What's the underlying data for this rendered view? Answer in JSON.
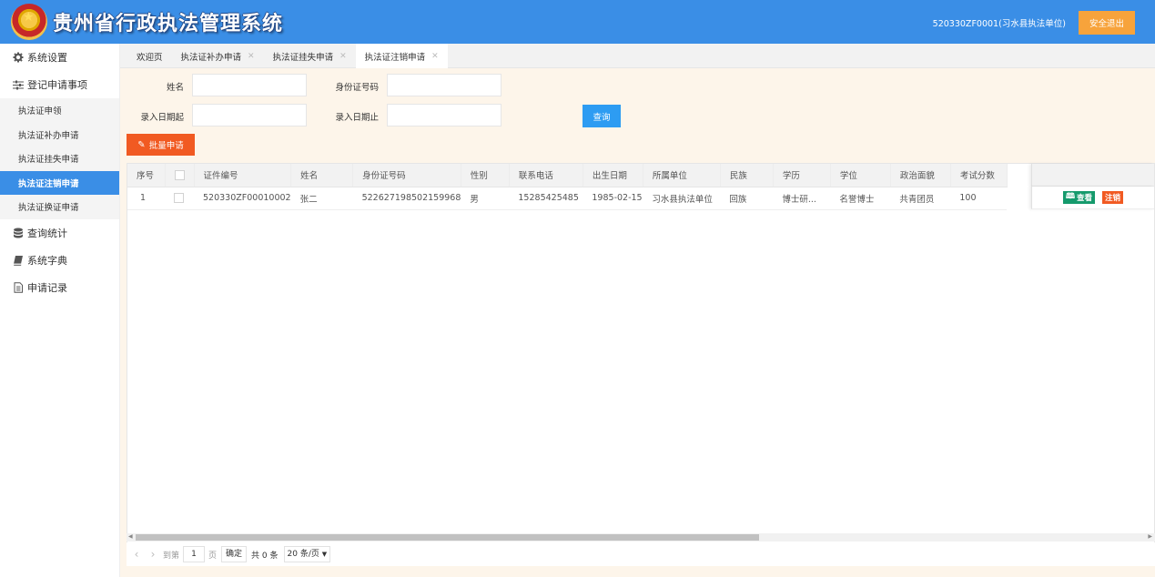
{
  "header": {
    "app_title": "贵州省行政执法管理系统",
    "user_info": "520330ZF0001(习水县执法单位)",
    "logout_label": "安全退出"
  },
  "sidebar": {
    "items": [
      {
        "label": "系统设置",
        "icon": "gear-icon"
      },
      {
        "label": "登记申请事项",
        "icon": "sliders-icon"
      }
    ],
    "submenu": [
      {
        "label": "执法证申领"
      },
      {
        "label": "执法证补办申请"
      },
      {
        "label": "执法证挂失申请"
      },
      {
        "label": "执法证注销申请",
        "active": true
      },
      {
        "label": "执法证换证申请"
      }
    ],
    "bottom_items": [
      {
        "label": "查询统计",
        "icon": "database-icon"
      },
      {
        "label": "系统字典",
        "icon": "book-icon"
      },
      {
        "label": "申请记录",
        "icon": "document-icon"
      }
    ]
  },
  "tabs": [
    {
      "label": "欢迎页",
      "closable": false
    },
    {
      "label": "执法证补办申请",
      "closable": true
    },
    {
      "label": "执法证挂失申请",
      "closable": true
    },
    {
      "label": "执法证注销申请",
      "closable": true,
      "active": true
    }
  ],
  "filter": {
    "name_label": "姓名",
    "idcard_label": "身份证号码",
    "date_from_label": "录入日期起",
    "date_to_label": "录入日期止",
    "query_label": "查询",
    "batch_label": "批量申请"
  },
  "table": {
    "columns": [
      "序号",
      "",
      "证件编号",
      "姓名",
      "身份证号码",
      "性别",
      "联系电话",
      "出生日期",
      "所属单位",
      "民族",
      "学历",
      "学位",
      "政治面貌",
      "考试分数"
    ],
    "rows": [
      [
        "1",
        "",
        "520330ZF00010002",
        "张二",
        "522627198502159968",
        "男",
        "15285425485",
        "1985-02-15",
        "习水县执法单位",
        "回族",
        "博士研...",
        "名誉博士",
        "共青团员",
        "100"
      ]
    ],
    "view_label": "查看",
    "cancel_label": "注销"
  },
  "pager": {
    "goto_label": "到第",
    "page_value": "1",
    "page_unit": "页",
    "confirm_label": "确定",
    "total_label": "共 0 条",
    "page_size": "20 条/页"
  },
  "colors": {
    "header_bg": "#3a8ee6",
    "logout_bg": "#f7a33b",
    "query_bg": "#2d9cf2",
    "batch_bg": "#f15a22",
    "view_bg": "#159a6c",
    "cancel_bg": "#f15a22"
  }
}
